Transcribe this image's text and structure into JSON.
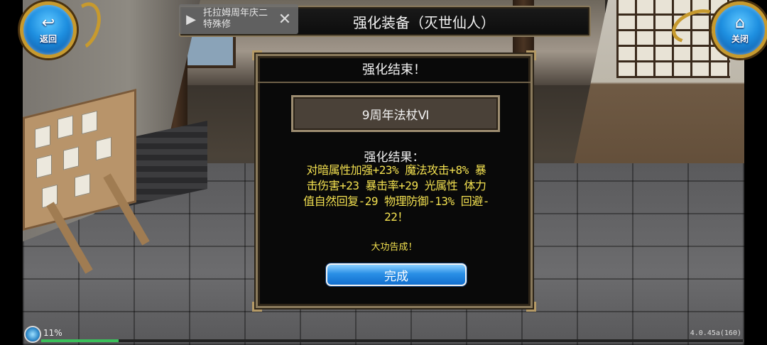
{
  "window": {
    "title": "强化装备（灭世仙人）"
  },
  "nav": {
    "back_label": "返回",
    "close_label": "关闭",
    "back_icon": "return-arrow-icon",
    "close_icon": "home-icon"
  },
  "ad": {
    "text": "托拉姆周年庆二特殊修",
    "close_symbol": "✕"
  },
  "dialog": {
    "header": "强化结束！",
    "item_name": "9周年法杖Ⅵ",
    "result_title": "强化结果：",
    "result_lines": [
      "对暗属性加强+23% 魔法攻击+8% 暴",
      "击伤害+23 暴击率+29 光属性 体力",
      "值自然回复-29 物理防御-13% 回避-",
      "22！"
    ],
    "success_text": "大功告成！",
    "done_label": "完成"
  },
  "status": {
    "percent_text": "11%",
    "progress": 0.11,
    "version": "4.0.45a(160)"
  },
  "colors": {
    "accent_blue": "#1e8fe0",
    "gold_frame": "#c79a2e",
    "result_yellow": "#f2e050"
  }
}
